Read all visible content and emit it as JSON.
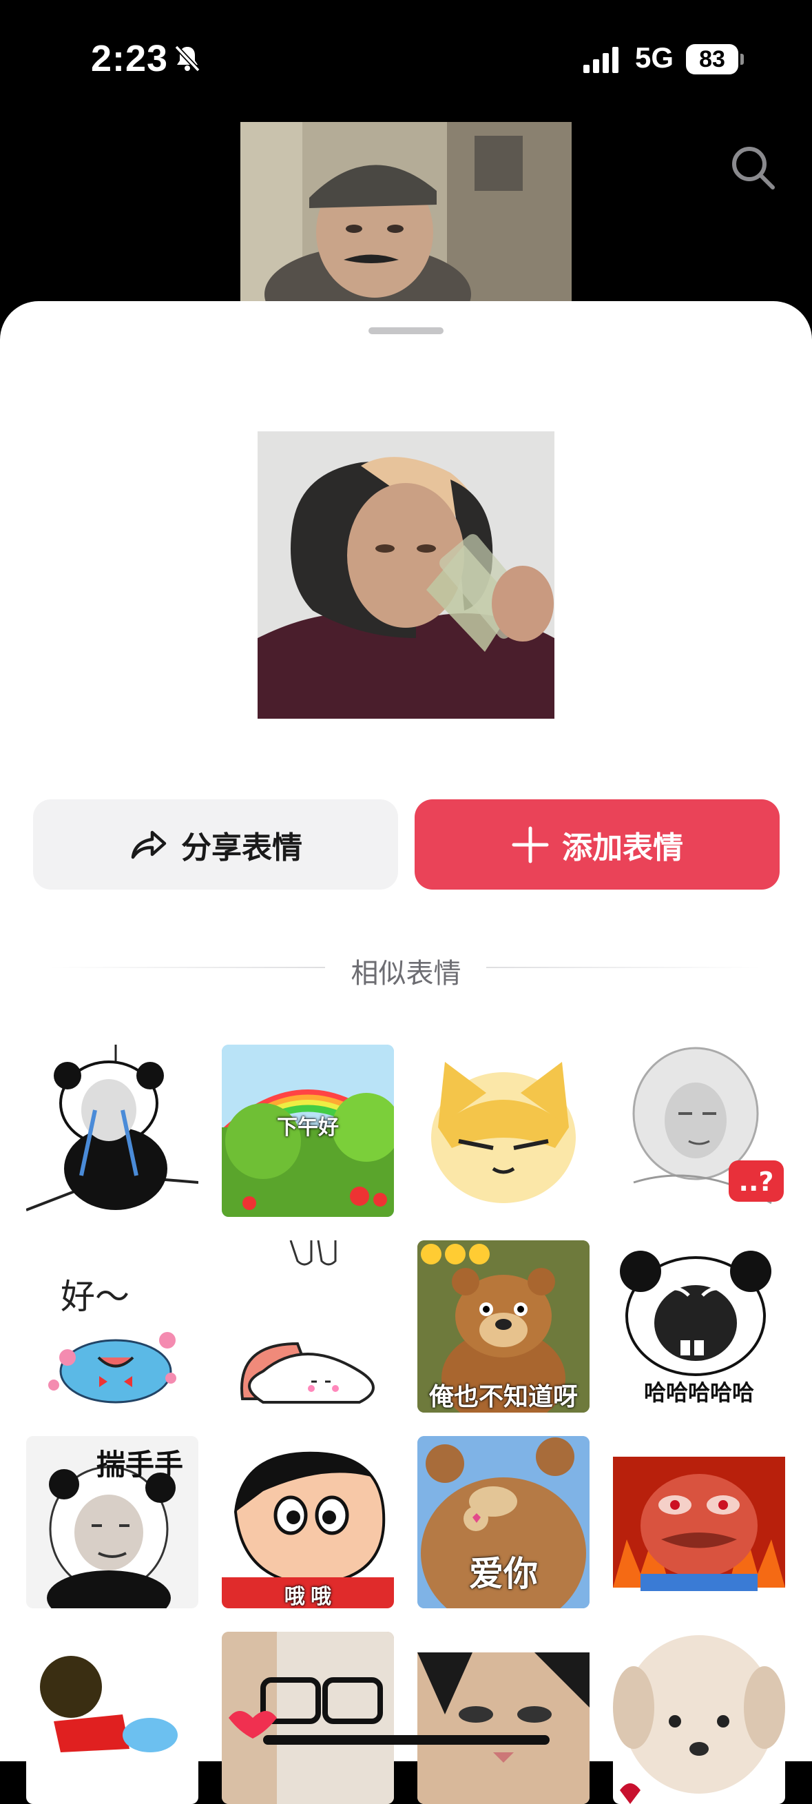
{
  "status_bar": {
    "time": "2:23",
    "network": "5G",
    "battery": "83"
  },
  "icons": {
    "bell": "bell-slash-icon",
    "signal": "signal-bars-icon",
    "search": "search-icon",
    "share": "share-arrow-icon",
    "add": "plus-icon"
  },
  "actions": {
    "share_label": "分享表情",
    "add_label": "添加表情"
  },
  "section": {
    "title": "相似表情"
  },
  "stickers": [
    {
      "caption": ""
    },
    {
      "caption": "下午好"
    },
    {
      "caption": ""
    },
    {
      "caption": ""
    },
    {
      "caption": "好～"
    },
    {
      "caption": ""
    },
    {
      "caption": "俺也不知道呀"
    },
    {
      "caption": "哈哈哈哈哈"
    },
    {
      "caption": "揣手手"
    },
    {
      "caption": "哦 哦"
    },
    {
      "caption": "爱你"
    },
    {
      "caption": ""
    },
    {
      "caption": ""
    },
    {
      "caption": ""
    },
    {
      "caption": ""
    },
    {
      "caption": ""
    }
  ],
  "colors": {
    "accent": "#ea4358",
    "share_bg": "#f2f2f3"
  }
}
